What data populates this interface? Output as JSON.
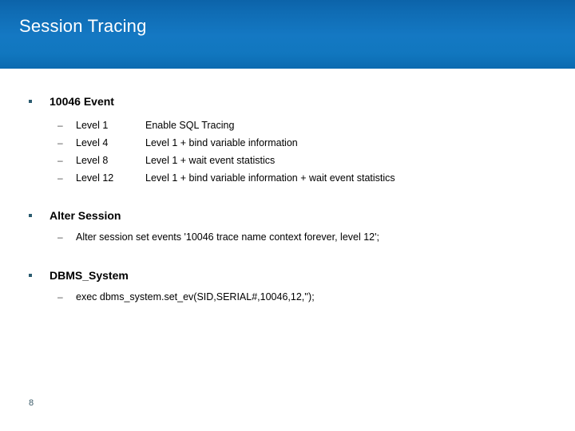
{
  "header": {
    "title": "Session Tracing",
    "gradient_top": "#0c63a9",
    "gradient_mid": "#1478c3",
    "gradient_bottom": "#0b6ab0"
  },
  "bullet_color": "#2c5c70",
  "sections": [
    {
      "title": "10046 Event",
      "rows": [
        {
          "label": "Level 1",
          "desc": "Enable SQL Tracing"
        },
        {
          "label": "Level 4",
          "desc": "Level 1 + bind variable information"
        },
        {
          "label": "Level 8",
          "desc": "Level 1 + wait event statistics"
        },
        {
          "label": "Level 12",
          "desc": "Level 1 + bind variable information + wait event statistics"
        }
      ]
    },
    {
      "title": "Alter Session",
      "rows": [
        {
          "text": "Alter session set events '10046 trace name context forever, level 12';"
        }
      ]
    },
    {
      "title": "DBMS_System",
      "rows": [
        {
          "text": "exec dbms_system.set_ev(SID,SERIAL#,10046,12,'');"
        }
      ]
    }
  ],
  "dash_glyph": "–",
  "footer": {
    "page_number": "8"
  }
}
